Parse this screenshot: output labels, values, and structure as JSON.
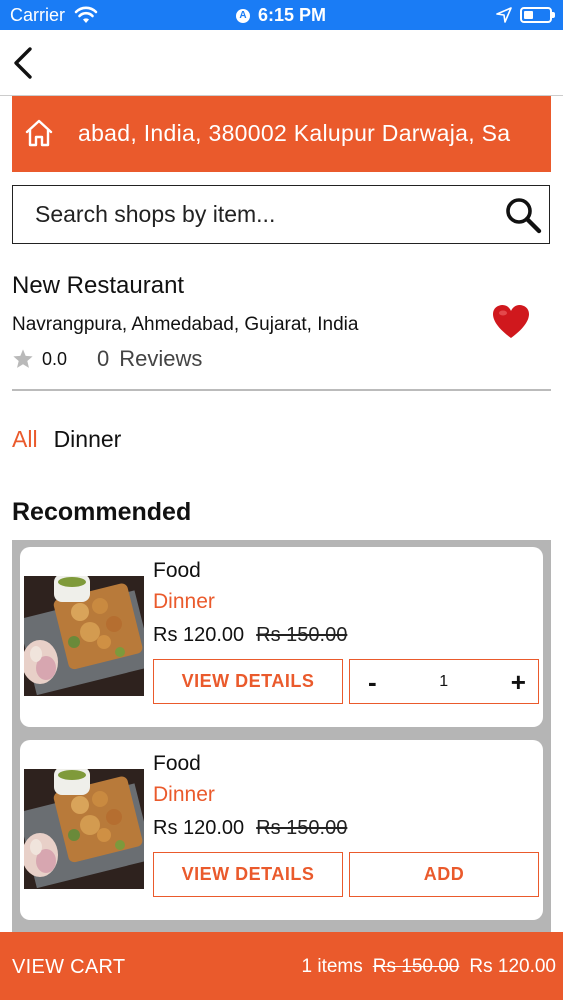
{
  "status_bar": {
    "carrier": "Carrier",
    "time": "6:15 PM",
    "background": "#1a7cf5",
    "icons": [
      "wifi-icon",
      "location-services-icon",
      "location-arrow-icon",
      "battery-icon"
    ]
  },
  "nav": {
    "back_icon": "chevron-left-icon"
  },
  "address_banner": {
    "text": "abad, India, 380002  Kalupur Darwaja, Sa",
    "icon": "home-icon",
    "background": "#ea5a2c"
  },
  "search": {
    "placeholder": "Search shops by item...",
    "value": "",
    "icon": "search-icon"
  },
  "restaurant": {
    "name": "New Restaurant",
    "location": "Navrangpura, Ahmedabad, Gujarat, India",
    "rating": "0.0",
    "review_count": "0",
    "reviews_label": "Reviews",
    "favorite_icon": "heart-icon",
    "favorite_color": "#d0181d"
  },
  "filters": {
    "all": "All",
    "dinner": "Dinner"
  },
  "section_title": "Recommended",
  "items": [
    {
      "title": "Food",
      "category": "Dinner",
      "price": "Rs 120.00",
      "old_price": "Rs 150.00",
      "details_label": "VIEW DETAILS",
      "quantity": "1",
      "minus": "-",
      "plus": "+"
    },
    {
      "title": "Food",
      "category": "Dinner",
      "price": "Rs 120.00",
      "old_price": "Rs 150.00",
      "details_label": "VIEW DETAILS",
      "add_label": "ADD"
    }
  ],
  "cart": {
    "label": "VIEW CART",
    "items": "1 items",
    "old_total": "Rs 150.00",
    "total": "Rs 120.00"
  },
  "colors": {
    "accent": "#ea5a2c",
    "list_background": "#b5b5b5"
  }
}
